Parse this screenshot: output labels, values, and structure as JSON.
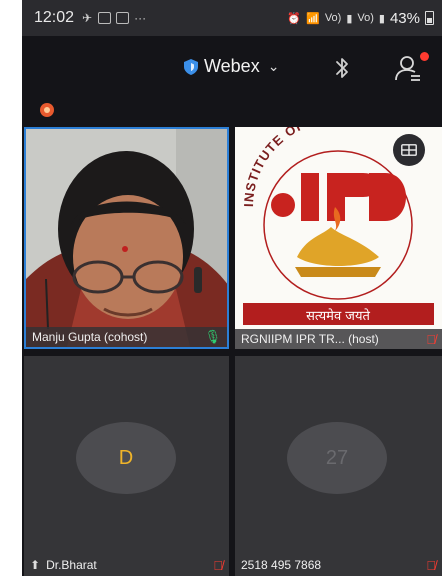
{
  "status_bar": {
    "time": "12:02",
    "overflow": "···",
    "net_label_1": "Vo)",
    "net_label_2": "Vo)",
    "battery_percent": "43%"
  },
  "app_bar": {
    "brand": "Webex"
  },
  "participants": [
    {
      "name": "Manju Gupta (cohost)",
      "mic": "on"
    },
    {
      "name": "RGNIIPM IPR TR... (host)",
      "mic": "muted"
    },
    {
      "name": "Dr.Bharat",
      "mic": "muted",
      "avatar_text": "D"
    },
    {
      "name": "2518 495 7868",
      "mic": "muted",
      "avatar_text": "27"
    }
  ],
  "logo": {
    "arc_text": "INSTITUTE OF INTELL",
    "footer_text": "सत्यमेव जयते"
  },
  "colors": {
    "accent_blue": "#2c7fd6",
    "muted_red": "#ff3b30",
    "unmuted_green": "#2ecc71",
    "avatar_letter": "#f0b429"
  }
}
